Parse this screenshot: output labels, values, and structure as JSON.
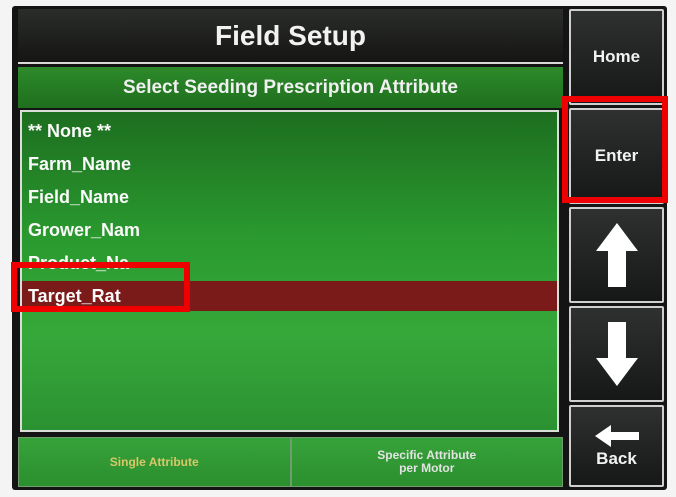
{
  "header": {
    "title": "Field Setup"
  },
  "subheader": {
    "title": "Select Seeding Prescription Attribute"
  },
  "attribute_list": {
    "items": [
      {
        "label": "** None **",
        "selected": false
      },
      {
        "label": "Farm_Name",
        "selected": false
      },
      {
        "label": "Field_Name",
        "selected": false
      },
      {
        "label": "Grower_Nam",
        "selected": false
      },
      {
        "label": "Product_Na",
        "selected": false
      },
      {
        "label": "Target_Rat",
        "selected": true
      }
    ]
  },
  "bottom_options": {
    "single_attribute": "Single Attribute",
    "specific_attribute_line1": "Specific Attribute",
    "specific_attribute_line2": "per Motor"
  },
  "side_buttons": {
    "home": "Home",
    "enter": "Enter",
    "up_icon": "arrow-up-icon",
    "down_icon": "arrow-down-icon",
    "back": "Back",
    "back_icon": "arrow-left-icon"
  },
  "colors": {
    "selected_row": "#7a1b1a",
    "list_green": "#2a9a2f",
    "highlight_box": "#ee0000",
    "active_option_text": "#d7c86a"
  }
}
